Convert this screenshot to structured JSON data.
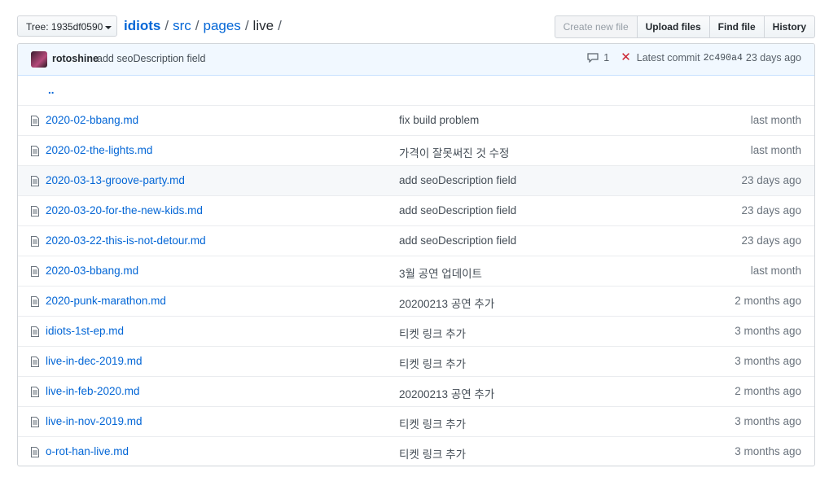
{
  "tree_button": {
    "label": "Tree: 1935df0590"
  },
  "breadcrumb": {
    "root": "idiots",
    "parts": [
      "src",
      "pages",
      "live"
    ],
    "trailing": "/"
  },
  "actions": {
    "create": "Create new file",
    "upload": "Upload files",
    "find": "Find file",
    "history": "History"
  },
  "commit": {
    "author": "rotoshine",
    "message": "add seoDescription field",
    "comments": "1",
    "latest_label": "Latest commit",
    "sha": "2c490a4",
    "age": "23 days ago"
  },
  "parent_dir": "..",
  "files": [
    {
      "name": "2020-02-bbang.md",
      "message": "fix build problem",
      "age": "last month"
    },
    {
      "name": "2020-02-the-lights.md",
      "message": "가격이 잘못써진 것 수정",
      "age": "last month"
    },
    {
      "name": "2020-03-13-groove-party.md",
      "message": "add seoDescription field",
      "age": "23 days ago"
    },
    {
      "name": "2020-03-20-for-the-new-kids.md",
      "message": "add seoDescription field",
      "age": "23 days ago"
    },
    {
      "name": "2020-03-22-this-is-not-detour.md",
      "message": "add seoDescription field",
      "age": "23 days ago"
    },
    {
      "name": "2020-03-bbang.md",
      "message": "3월 공연 업데이트",
      "age": "last month"
    },
    {
      "name": "2020-punk-marathon.md",
      "message": "20200213 공연 추가",
      "age": "2 months ago"
    },
    {
      "name": "idiots-1st-ep.md",
      "message": "티켓 링크 추가",
      "age": "3 months ago"
    },
    {
      "name": "live-in-dec-2019.md",
      "message": "티켓 링크 추가",
      "age": "3 months ago"
    },
    {
      "name": "live-in-feb-2020.md",
      "message": "20200213 공연 추가",
      "age": "2 months ago"
    },
    {
      "name": "live-in-nov-2019.md",
      "message": "티켓 링크 추가",
      "age": "3 months ago"
    },
    {
      "name": "o-rot-han-live.md",
      "message": "티켓 링크 추가",
      "age": "3 months ago"
    }
  ],
  "colors": {
    "link": "#0366d6",
    "commit_bar": "#f1f8ff",
    "fail_icon": "#cb2431"
  }
}
